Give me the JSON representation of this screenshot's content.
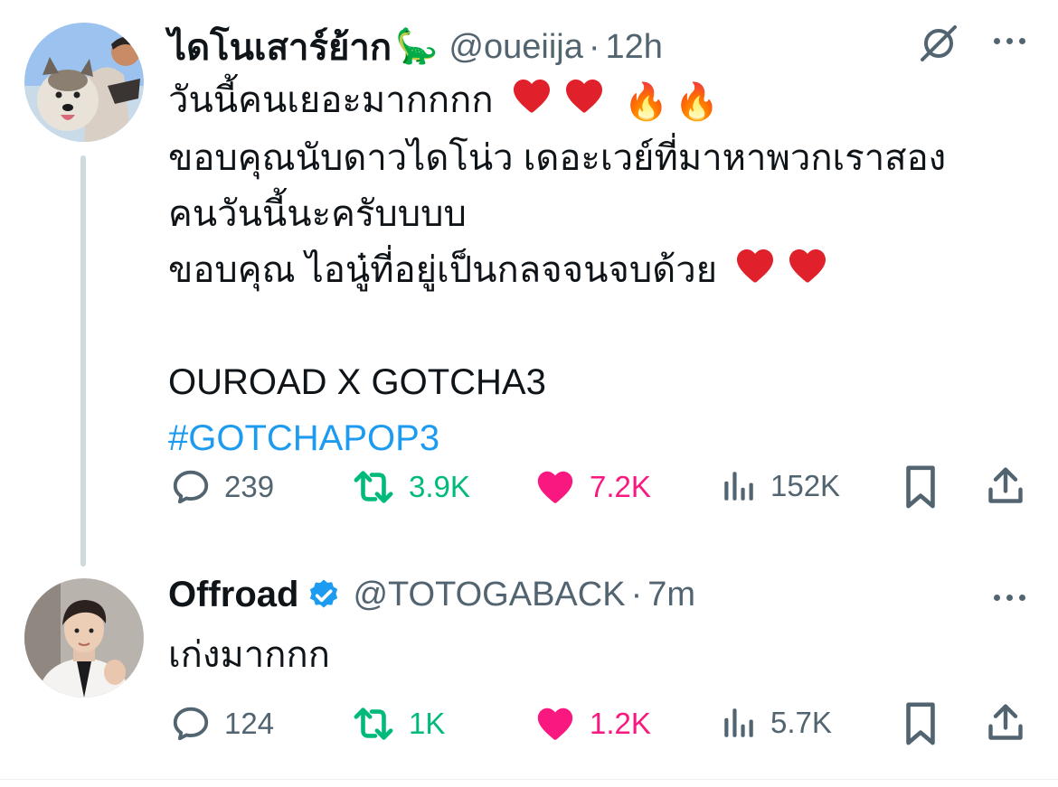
{
  "tweets": [
    {
      "name": "ไดโนเสาร์ย้าก",
      "name_emoji": "🦕",
      "handle": "@oueiija",
      "time": "12h",
      "lines": {
        "l1": "วันนี้คนเยอะมากกกก",
        "l2": "ขอบคุณนับดาวไดโน่ว เดอะเวย์ที่มาหาพวกเราสอง",
        "l3": "คนวันนี้นะครับบบบ",
        "l4": "ขอบคุณ ไอนู๋ที่อยู่เป็นกลจจนจบด้วย",
        "l5": "OUROAD X GOTCHA3",
        "hashtag": "#GOTCHAPOP3"
      },
      "emoji_fire": "🔥",
      "stats": {
        "replies": "239",
        "reposts": "3.9K",
        "likes": "7.2K",
        "views": "152K"
      }
    },
    {
      "name": "Offroad",
      "handle": "@TOTOGABACK",
      "time": "7m",
      "verified": true,
      "text": "เก่งมากกก",
      "stats": {
        "replies": "124",
        "reposts": "1K",
        "likes": "1.2K",
        "views": "5.7K"
      }
    }
  ],
  "icons": {
    "reply": "reply-icon",
    "repost": "repost-icon",
    "like": "heart-icon",
    "views": "views-icon",
    "bookmark": "bookmark-icon",
    "share": "share-icon",
    "more": "more-icon",
    "grok": "grok-icon",
    "verified": "verified-badge-icon"
  },
  "colors": {
    "text": "#0f1419",
    "secondary": "#536471",
    "link": "#1d9bf0",
    "repost": "#00ba7c",
    "like": "#f91880",
    "verified": "#1d9bf0"
  }
}
